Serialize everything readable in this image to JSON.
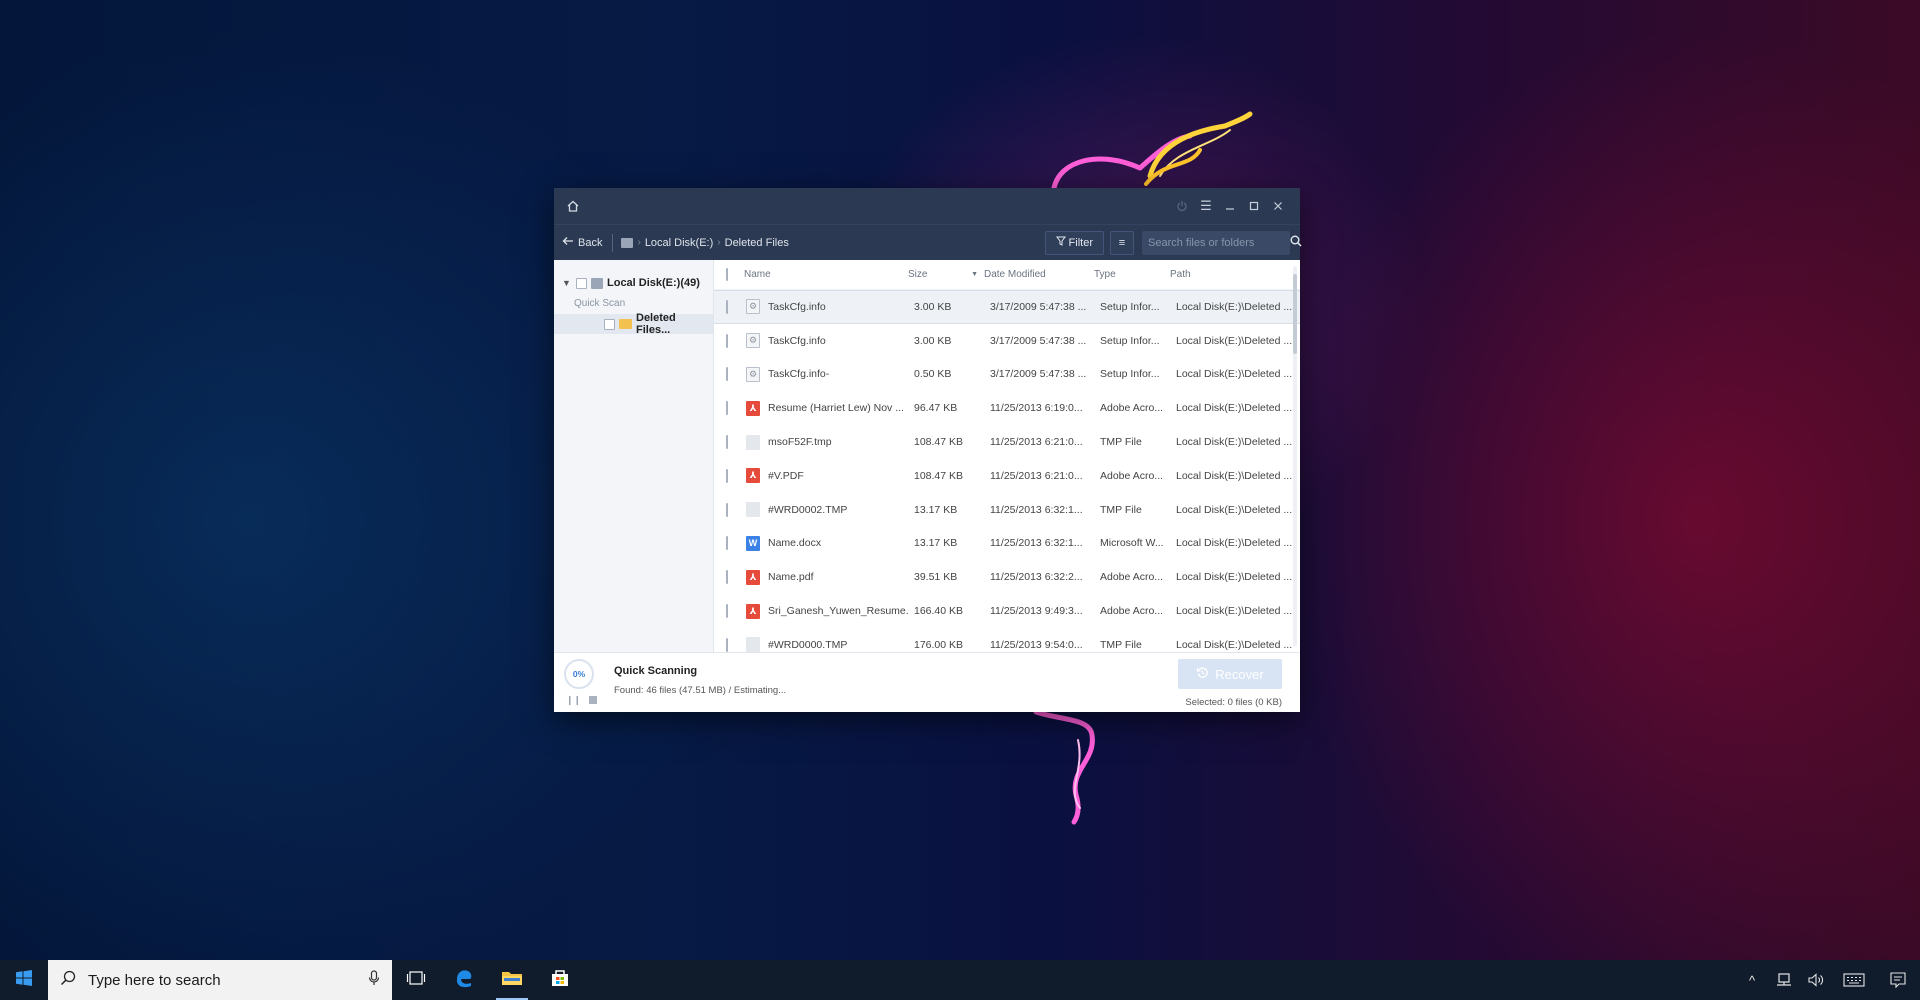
{
  "window": {
    "nav": {
      "back_label": "Back",
      "breadcrumb": [
        "Local Disk(E:)",
        "Deleted Files"
      ],
      "filter_label": "Filter",
      "search_placeholder": "Search files or folders"
    },
    "tree": {
      "root_label": "Local Disk(E:)(49)",
      "section_label": "Quick Scan",
      "folder_label": "Deleted Files..."
    },
    "table": {
      "columns": [
        "Name",
        "Size",
        "Date Modified",
        "Type",
        "Path"
      ],
      "rows": [
        {
          "icon": "setup",
          "name": "TaskCfg.info",
          "size": "3.00 KB",
          "date": "3/17/2009 5:47:38 ...",
          "type": "Setup Infor...",
          "path": "Local Disk(E:)\\Deleted ..."
        },
        {
          "icon": "setup",
          "name": "TaskCfg.info",
          "size": "3.00 KB",
          "date": "3/17/2009 5:47:38 ...",
          "type": "Setup Infor...",
          "path": "Local Disk(E:)\\Deleted ..."
        },
        {
          "icon": "setup",
          "name": "TaskCfg.info-",
          "size": "0.50 KB",
          "date": "3/17/2009 5:47:38 ...",
          "type": "Setup Infor...",
          "path": "Local Disk(E:)\\Deleted ..."
        },
        {
          "icon": "pdf",
          "name": "Resume (Harriet Lew) Nov ...",
          "size": "96.47 KB",
          "date": "11/25/2013 6:19:0...",
          "type": "Adobe Acro...",
          "path": "Local Disk(E:)\\Deleted ..."
        },
        {
          "icon": "tmp",
          "name": "msoF52F.tmp",
          "size": "108.47 KB",
          "date": "11/25/2013 6:21:0...",
          "type": "TMP File",
          "path": "Local Disk(E:)\\Deleted ..."
        },
        {
          "icon": "pdf",
          "name": "#V.PDF",
          "size": "108.47 KB",
          "date": "11/25/2013 6:21:0...",
          "type": "Adobe Acro...",
          "path": "Local Disk(E:)\\Deleted ..."
        },
        {
          "icon": "tmp",
          "name": "#WRD0002.TMP",
          "size": "13.17 KB",
          "date": "11/25/2013 6:32:1...",
          "type": "TMP File",
          "path": "Local Disk(E:)\\Deleted ..."
        },
        {
          "icon": "word",
          "name": "Name.docx",
          "size": "13.17 KB",
          "date": "11/25/2013 6:32:1...",
          "type": "Microsoft W...",
          "path": "Local Disk(E:)\\Deleted ..."
        },
        {
          "icon": "pdf",
          "name": "Name.pdf",
          "size": "39.51 KB",
          "date": "11/25/2013 6:32:2...",
          "type": "Adobe Acro...",
          "path": "Local Disk(E:)\\Deleted ..."
        },
        {
          "icon": "pdf",
          "name": "Sri_Ganesh_Yuwen_Resume...",
          "size": "166.40 KB",
          "date": "11/25/2013 9:49:3...",
          "type": "Adobe Acro...",
          "path": "Local Disk(E:)\\Deleted ..."
        },
        {
          "icon": "tmp",
          "name": "#WRD0000.TMP",
          "size": "176.00 KB",
          "date": "11/25/2013 9:54:0...",
          "type": "TMP File",
          "path": "Local Disk(E:)\\Deleted ..."
        }
      ]
    },
    "footer": {
      "progress_label": "0%",
      "progress": 0,
      "scan_title": "Quick Scanning",
      "found_text": "Found: 46 files (47.51 MB) / Estimating...",
      "recover_label": "Recover",
      "selected_text": "Selected: 0 files (0 KB)"
    }
  },
  "taskbar": {
    "search_placeholder": "Type here to search"
  },
  "colors": {
    "titlebar": "#2b3a52",
    "pdf_icon": "#e64a3b",
    "word_icon": "#3b82e6",
    "folder_icon": "#f2c14e",
    "recover_disabled": "#d8e4f3"
  }
}
